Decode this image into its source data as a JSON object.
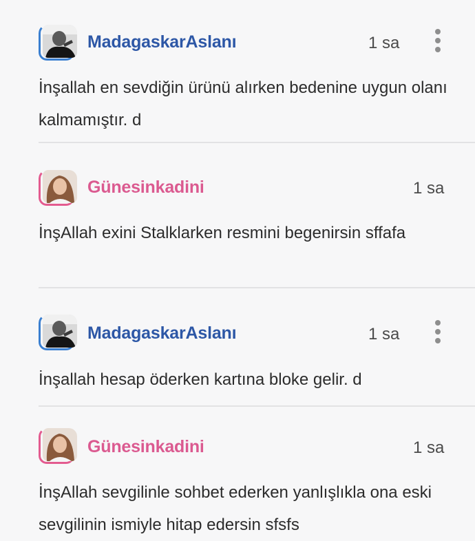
{
  "comments": [
    {
      "username": "MadagaskarAslanı",
      "time": "1 sa",
      "text": "İnşallah en sevdiğin ürünü alırken bedenine uygun olanı kalmamıştır. d",
      "name_color": "#2d57a6",
      "avatar_icon": "avatar-man-photo",
      "has_menu": true
    },
    {
      "username": "Günesinkadini",
      "time": "1 sa",
      "text": "İnşAllah exini Stalklarken resmini begenirsin sffafa",
      "name_color": "#db5a90",
      "avatar_icon": "avatar-woman-photo",
      "has_menu": false
    },
    {
      "username": "MadagaskarAslanı",
      "time": "1 sa",
      "text": "İnşallah hesap öderken kartına bloke gelir. d",
      "name_color": "#2d57a6",
      "avatar_icon": "avatar-man-photo",
      "has_menu": true
    },
    {
      "username": "Günesinkadini",
      "time": "1 sa",
      "text": "İnşAllah sevgilinle sohbet ederken yanlışlıkla ona eski sevgilinin ismiyle hitap edersin sfsfs",
      "name_color": "#db5a90",
      "avatar_icon": "avatar-woman-photo",
      "has_menu": false
    }
  ]
}
